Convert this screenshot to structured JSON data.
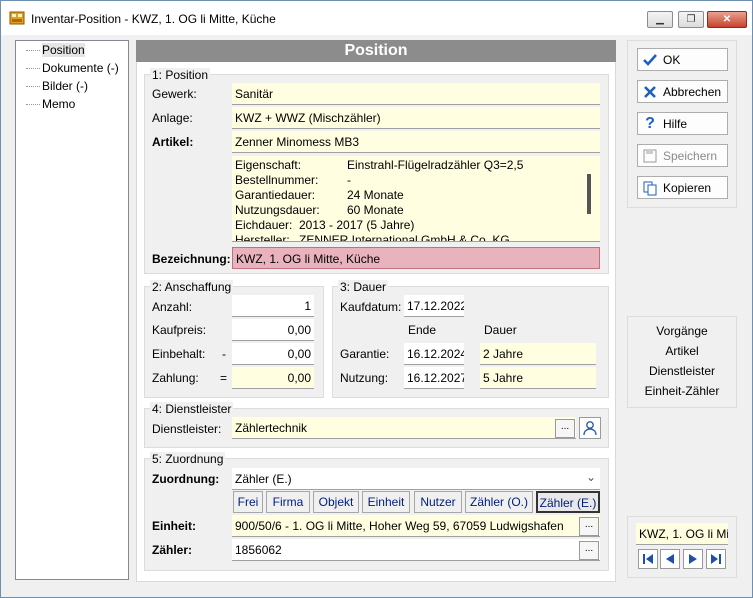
{
  "window": {
    "title": "Inventar-Position - KWZ, 1. OG li Mitte, Küche"
  },
  "tree": {
    "items": [
      "Position",
      "Dokumente (-)",
      "Bilder (-)",
      "Memo"
    ]
  },
  "header": {
    "title": "Position"
  },
  "position": {
    "group_title": "1: Position",
    "gewerk_label": "Gewerk:",
    "gewerk_value": "Sanitär",
    "anlage_label": "Anlage:",
    "anlage_value": "KWZ + WWZ (Mischzähler)",
    "artikel_label": "Artikel:",
    "artikel_value": "Zenner Minomess MB3",
    "details": [
      {
        "key": "Eigenschaft:",
        "value": "Einstrahl-Flügelradzähler Q3=2,5"
      },
      {
        "key": "Bestellnummer:",
        "value": "-"
      },
      {
        "key": "Garantiedauer:",
        "value": "24 Monate"
      },
      {
        "key": "Nutzungsdauer:",
        "value": "60 Monate"
      },
      {
        "key": "Eichdauer:",
        "value": "2013 - 2017 (5 Jahre)"
      },
      {
        "key": "Hersteller:",
        "value": "ZENNER International GmbH & Co. KG"
      }
    ],
    "bezeichnung_label": "Bezeichnung:",
    "bezeichnung_value": "KWZ, 1. OG li Mitte, Küche"
  },
  "anschaffung": {
    "group_title": "2: Anschaffung",
    "anzahl_label": "Anzahl:",
    "anzahl_value": "1",
    "kaufpreis_label": "Kaufpreis:",
    "kaufpreis_value": "0,00",
    "einbehalt_label": "Einbehalt:",
    "einbehalt_op": "-",
    "einbehalt_value": "0,00",
    "zahlung_label": "Zahlung:",
    "zahlung_op": "=",
    "zahlung_value": "0,00"
  },
  "dauer": {
    "group_title": "3: Dauer",
    "kaufdatum_label": "Kaufdatum:",
    "kaufdatum_value": "17.12.2022",
    "col_ende": "Ende",
    "col_dauer": "Dauer",
    "garantie_label": "Garantie:",
    "garantie_ende": "16.12.2024",
    "garantie_dauer": "2 Jahre",
    "nutzung_label": "Nutzung:",
    "nutzung_ende": "16.12.2027",
    "nutzung_dauer": "5 Jahre"
  },
  "dienstleister": {
    "group_title": "4: Dienstleister",
    "label": "Dienstleister:",
    "value": "Zählertechnik",
    "browse": "..."
  },
  "zuordnung": {
    "group_title": "5: Zuordnung",
    "label": "Zuordnung:",
    "value": "Zähler (E.)",
    "tabs": [
      "Frei",
      "Firma",
      "Objekt",
      "Einheit",
      "Nutzer",
      "Zähler (O.)",
      "Zähler (E.)"
    ],
    "einheit_label": "Einheit:",
    "einheit_value": "900/50/6 - 1. OG li Mitte, Hoher Weg 59, 67059 Ludwigshafen",
    "zaehler_label": "Zähler:",
    "zaehler_value": "1856062",
    "browse": "..."
  },
  "actions": {
    "ok": "OK",
    "abbrechen": "Abbrechen",
    "hilfe": "Hilfe",
    "speichern": "Speichern",
    "kopieren": "Kopieren"
  },
  "links": {
    "items": [
      "Vorgänge",
      "Artikel",
      "Dienstleister",
      "Einheit-Zähler"
    ]
  },
  "navigator": {
    "value": "KWZ, 1. OG li Mi"
  }
}
